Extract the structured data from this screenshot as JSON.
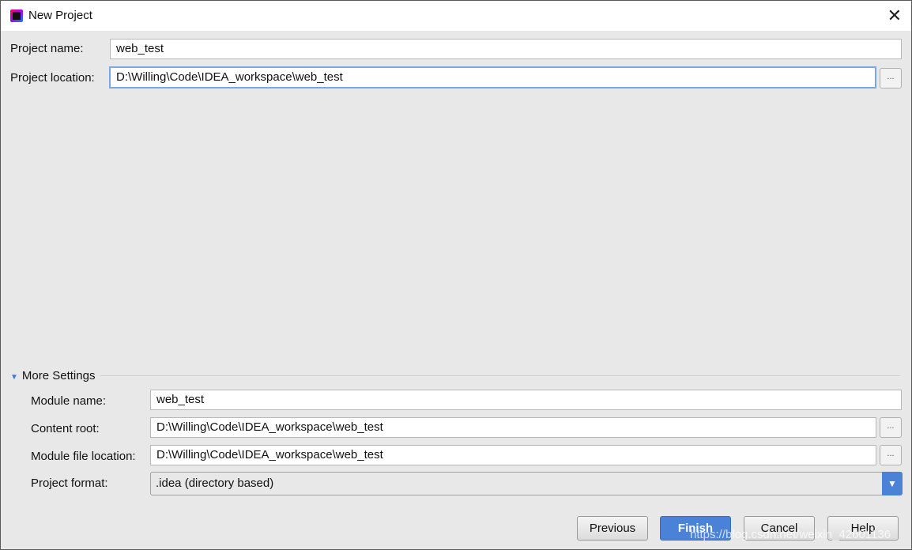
{
  "window": {
    "title": "New Project",
    "close": "✕"
  },
  "project": {
    "name_label": "Project name:",
    "name_value": "web_test",
    "location_label": "Project location:",
    "location_value": "D:\\Willing\\Code\\IDEA_workspace\\web_test",
    "browse": "..."
  },
  "more_settings": {
    "label": "More Settings",
    "module_name_label": "Module name:",
    "module_name_value": "web_test",
    "content_root_label": "Content root:",
    "content_root_value": "D:\\Willing\\Code\\IDEA_workspace\\web_test",
    "module_file_label": "Module file location:",
    "module_file_value": "D:\\Willing\\Code\\IDEA_workspace\\web_test",
    "format_label": "Project format:",
    "format_value": ".idea (directory based)"
  },
  "buttons": {
    "previous": "Previous",
    "finish": "Finish",
    "cancel": "Cancel",
    "help": "Help"
  },
  "watermark": "https://blog.csdn.net/weixin_42601136",
  "colors": {
    "accent": "#4a82d8"
  }
}
